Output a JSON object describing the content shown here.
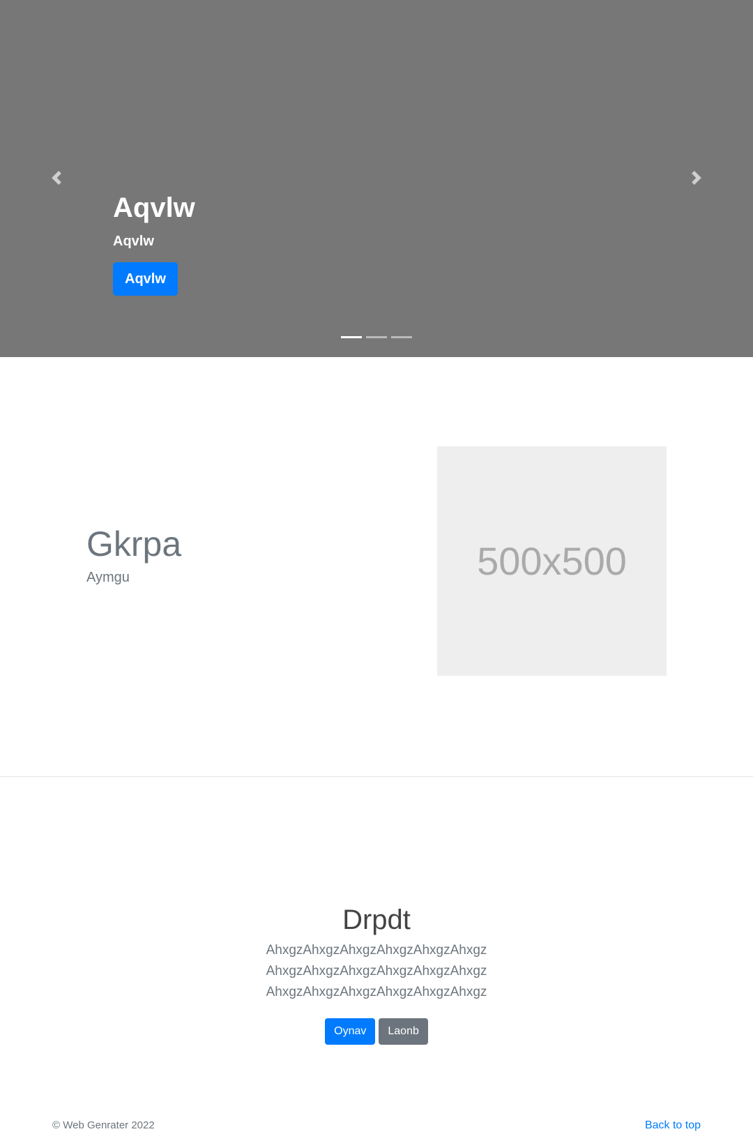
{
  "carousel": {
    "title": "Aqvlw",
    "text": "Aqvlw",
    "button_label": "Aqvlw",
    "prev_icon": "chevron-left-icon",
    "next_icon": "chevron-right-icon",
    "slide_count": 3,
    "active_slide": 1,
    "background_color": "#777777"
  },
  "feature": {
    "heading": "Gkrpa",
    "lead": "Aymgu",
    "image_label": "500x500"
  },
  "jumbotron": {
    "heading": "Drpdt",
    "lines": [
      "AhxgzAhxgzAhxgzAhxgzAhxgzAhxgz",
      "AhxgzAhxgzAhxgzAhxgzAhxgzAhxgz",
      "AhxgzAhxgzAhxgzAhxgzAhxgzAhxgz"
    ],
    "primary_button": "Oynav",
    "secondary_button": "Laonb"
  },
  "footer": {
    "copyright": "© Web Genrater 2022",
    "back_to_top": "Back to top"
  },
  "colors": {
    "primary": "#007bff",
    "secondary": "#6c757d"
  }
}
